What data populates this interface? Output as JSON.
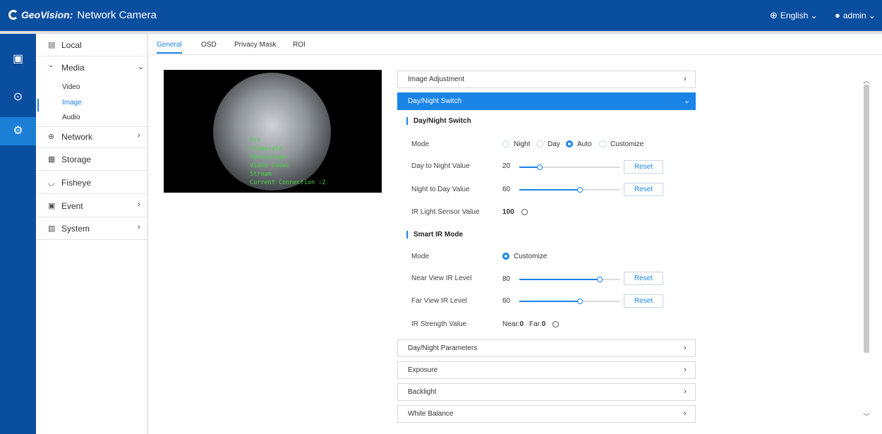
{
  "header": {
    "brand": "GeoVision:",
    "title": "Network Camera",
    "language": "English",
    "user": "admin"
  },
  "rail": {
    "icons": [
      "monitor-icon",
      "playback-icon",
      "settings-icon"
    ]
  },
  "sidebar": {
    "local": "Local",
    "media": "Media",
    "media_sub": [
      "Video",
      "Image",
      "Audio"
    ],
    "network": "Network",
    "storage": "Storage",
    "fisheye": "Fisheye",
    "event": "Event",
    "system": "System"
  },
  "tabs": [
    "General",
    "OSD",
    "Privacy Mask",
    "ROI"
  ],
  "preview": {
    "osd_lines": [
      "Pro",
      "Framerate",
      "Resolution",
      "Video Codec",
      "Stream",
      "Current Connection :2"
    ]
  },
  "sections": {
    "image_adjustment": "Image Adjustment",
    "day_night_switch": "Day/Night Switch",
    "day_night_parameters": "Day/Night Parameters",
    "exposure": "Exposure",
    "backlight": "Backlight",
    "white_balance": "White Balance"
  },
  "day_night": {
    "heading": "Day/Night Switch",
    "mode_label": "Mode",
    "mode_options": [
      "Night",
      "Day",
      "Auto",
      "Customize"
    ],
    "mode_selected": "Auto",
    "day_to_night_label": "Day to Night Value",
    "day_to_night_value": "20",
    "day_to_night_pct": 0.2,
    "night_to_day_label": "Night to Day Value",
    "night_to_day_value": "60",
    "night_to_day_pct": 0.6,
    "ir_sensor_label": "IR Light Sensor Value",
    "ir_sensor_value": "100",
    "reset": "Reset"
  },
  "smart_ir": {
    "heading": "Smart IR Mode",
    "mode_label": "Mode",
    "mode_option": "Customize",
    "near_label": "Near View IR Level",
    "near_value": "80",
    "near_pct": 0.8,
    "far_label": "Far View IR Level",
    "far_value": "60",
    "far_pct": 0.6,
    "strength_label": "IR Strength Value",
    "near_text": "Near:",
    "near_strength": "0",
    "far_text": "Far:",
    "far_strength": "0",
    "reset": "Reset"
  },
  "colors": {
    "brand": "#0a4ea0",
    "accent": "#1b84e7"
  }
}
